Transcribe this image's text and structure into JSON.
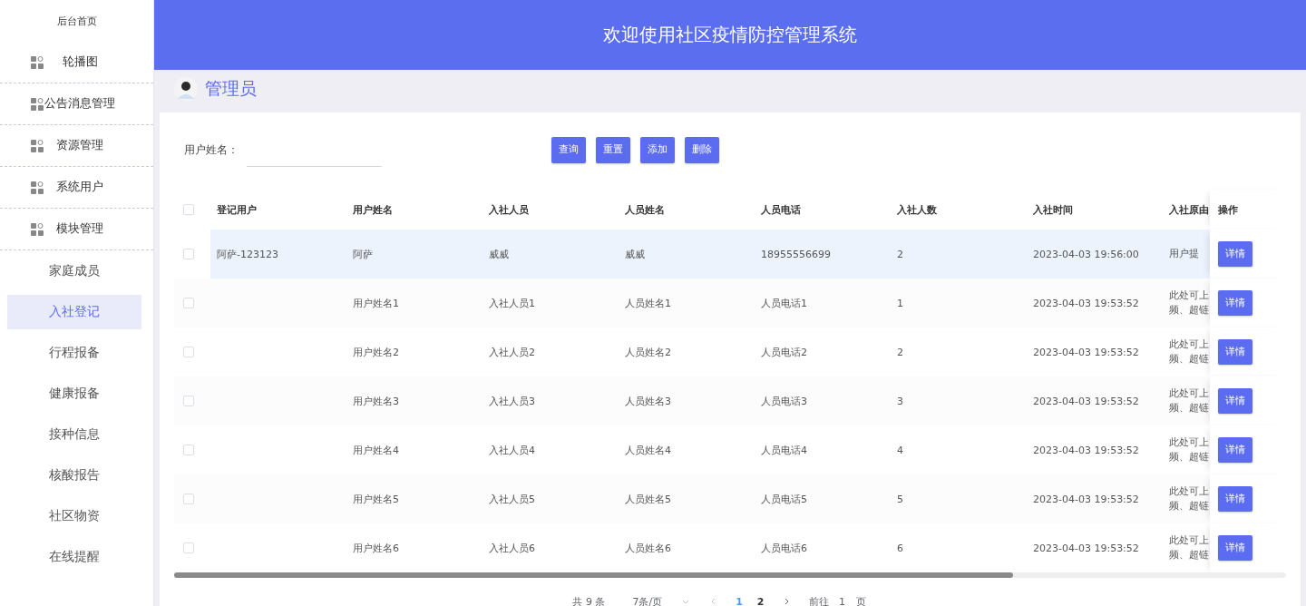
{
  "sidebar": {
    "home": "后台首页",
    "items": [
      {
        "label": "轮播图"
      },
      {
        "label": "公告消息管理"
      },
      {
        "label": "资源管理"
      },
      {
        "label": "系统用户"
      },
      {
        "label": "模块管理",
        "children": [
          {
            "label": "家庭成员",
            "selected": false
          },
          {
            "label": "入社登记",
            "selected": true
          },
          {
            "label": "行程报备",
            "selected": false
          },
          {
            "label": "健康报备",
            "selected": false
          },
          {
            "label": "接种信息",
            "selected": false
          },
          {
            "label": "核酸报告",
            "selected": false
          },
          {
            "label": "社区物资",
            "selected": false
          },
          {
            "label": "在线提醒",
            "selected": false
          }
        ]
      }
    ]
  },
  "header": {
    "title": "欢迎使用社区疫情防控管理系统"
  },
  "user": {
    "name": "管理员"
  },
  "search": {
    "label": "用户姓名：",
    "buttons": [
      "查询",
      "重置",
      "添加",
      "删除"
    ]
  },
  "table": {
    "all_checked": false,
    "columns": [
      "登记用户",
      "用户姓名",
      "入社人员",
      "人员姓名",
      "人员电话",
      "入社人数",
      "入社时间",
      "入社原由"
    ],
    "action_column": "操作",
    "rows": [
      {
        "checked": false,
        "highlighted": true,
        "cells": [
          "阿萨-123123",
          "阿萨",
          "威威",
          "威威",
          "18955556699",
          "2",
          "2023-04-03 19:56:00",
          "用户提"
        ],
        "action": "详情"
      },
      {
        "checked": false,
        "highlighted": false,
        "cells": [
          null,
          "用户姓名1",
          "入社人员1",
          "人员姓名1",
          "人员电话1",
          "1",
          "2023-04-03 19:53:52",
          "此处可上频、超链"
        ],
        "action": "详情"
      },
      {
        "checked": false,
        "highlighted": false,
        "cells": [
          null,
          "用户姓名2",
          "入社人员2",
          "人员姓名2",
          "人员电话2",
          "2",
          "2023-04-03 19:53:52",
          "此处可上频、超链"
        ],
        "action": "详情"
      },
      {
        "checked": false,
        "highlighted": false,
        "cells": [
          null,
          "用户姓名3",
          "入社人员3",
          "人员姓名3",
          "人员电话3",
          "3",
          "2023-04-03 19:53:52",
          "此处可上频、超链"
        ],
        "action": "详情"
      },
      {
        "checked": false,
        "highlighted": false,
        "cells": [
          null,
          "用户姓名4",
          "入社人员4",
          "人员姓名4",
          "人员电话4",
          "4",
          "2023-04-03 19:53:52",
          "此处可上频、超链"
        ],
        "action": "详情"
      },
      {
        "checked": false,
        "highlighted": false,
        "cells": [
          null,
          "用户姓名5",
          "入社人员5",
          "人员姓名5",
          "人员电话5",
          "5",
          "2023-04-03 19:53:52",
          "此处可上频、超链"
        ],
        "action": "详情"
      },
      {
        "checked": false,
        "highlighted": false,
        "cells": [
          null,
          "用户姓名6",
          "入社人员6",
          "人员姓名6",
          "人员电话6",
          "6",
          "2023-04-03 19:53:52",
          "此处可上频、超链"
        ],
        "action": "详情"
      }
    ]
  },
  "pagination": {
    "total": "共 9 条",
    "page_size": "7条/页",
    "pages": [
      {
        "label": "1",
        "selected": true
      },
      {
        "label": "2",
        "selected": false
      }
    ],
    "goto_label": "前往",
    "goto_value": "1",
    "page_unit": "页"
  }
}
